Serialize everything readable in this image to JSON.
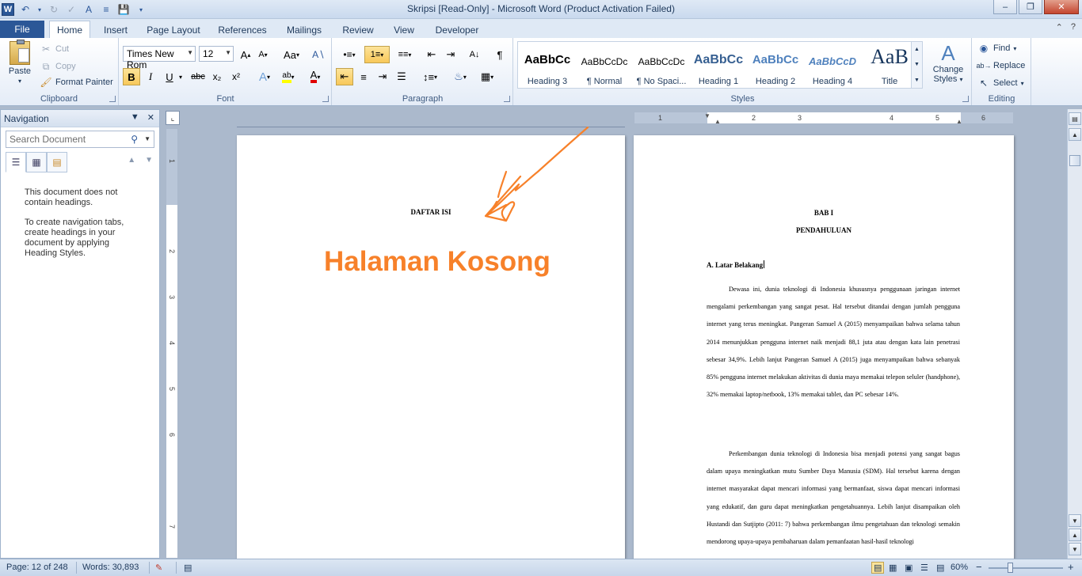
{
  "window": {
    "title": "Skripsi [Read-Only]  -  Microsoft Word (Product Activation Failed)",
    "minimize": "–",
    "restore": "❐",
    "close": "✕"
  },
  "tabs": {
    "file": "File",
    "items": [
      "Home",
      "Insert",
      "Page Layout",
      "References",
      "Mailings",
      "Review",
      "View",
      "Developer"
    ],
    "help": "?"
  },
  "ribbon": {
    "clipboard": {
      "label": "Clipboard",
      "paste": "Paste",
      "cut": "Cut",
      "copy": "Copy",
      "format_painter": "Format Painter"
    },
    "font": {
      "label": "Font",
      "font_name": "Times New Rom",
      "font_size": "12",
      "bold": "B",
      "italic": "I",
      "underline": "U",
      "strike": "abc",
      "subscript": "x₂",
      "superscript": "x²"
    },
    "paragraph": {
      "label": "Paragraph"
    },
    "styles": {
      "label": "Styles",
      "items": [
        {
          "sample": "AaBbCc",
          "name": "Heading 3"
        },
        {
          "sample": "AaBbCcDc",
          "name": "¶ Normal"
        },
        {
          "sample": "AaBbCcDc",
          "name": "¶ No Spaci..."
        },
        {
          "sample": "AaBbCc",
          "name": "Heading 1"
        },
        {
          "sample": "AaBbCc",
          "name": "Heading 2"
        },
        {
          "sample": "AaBbCcD",
          "name": "Heading 4"
        },
        {
          "sample": "AaB",
          "name": "Title"
        }
      ],
      "change_styles": "Change",
      "change_styles_2": "Styles"
    },
    "editing": {
      "label": "Editing",
      "find": "Find",
      "replace": "Replace",
      "select": "Select"
    }
  },
  "navigation": {
    "title": "Navigation",
    "search_placeholder": "Search Document",
    "msg1": "This document does not contain headings.",
    "msg2": "To create navigation tabs, create headings in your document by applying Heading Styles."
  },
  "ruler": {
    "h_numbers": [
      "1",
      "2",
      "3",
      "4",
      "5",
      "6"
    ],
    "v_numbers": [
      "1",
      "2",
      "3",
      "4",
      "5",
      "6",
      "7"
    ]
  },
  "document": {
    "page1": {
      "title": "DAFTAR ISI",
      "annotation": "Halaman Kosong"
    },
    "page2": {
      "bab": "BAB I",
      "bab_title": "PENDAHULUAN",
      "subheading": "A.  Latar Belakang",
      "para1": "Dewasa ini, dunia teknologi di Indonesia khususnya penggunaan jaringan internet mengalami perkembangan yang sangat pesat. Hal tersebut ditandai dengan jumlah pengguna internet yang terus meningkat. Pangeran Samuel A (2015) menyampaikan bahwa selama tahun 2014 menunjukkan pengguna internet naik menjadi 88,1 juta atau dengan kata lain penetrasi sebesar 34,9%. Lebih lanjut Pangeran  Samuel A (2015) juga menyampaikan bahwa sebanyak 85% pengguna internet melakukan aktivitas di dunia maya memakai telepon seluler (handphone), 32% memakai laptop/netbook, 13% memakai tablet, dan PC sebesar 14%.",
      "para2": "Perkembangan dunia teknologi di Indonesia bisa menjadi potensi yang sangat bagus dalam upaya meningkatkan mutu Sumber Daya Manusia (SDM). Hal tersebut karena dengan internet masyarakat dapat mencari informasi yang bermanfaat, siswa dapat mencari informasi yang edukatif, dan guru dapat meningkatkan pengetahuannya. Lebih lanjut disampaikan oleh Hustandi dan Sutjipto (2011: 7) bahwa perkembangan ilmu pengetahuan dan teknologi semakin mendorong upaya-upaya pembaharuan dalam pemanfaatan hasil-hasil teknologi"
    }
  },
  "status": {
    "page": "Page: 12 of 248",
    "words": "Words: 30,893",
    "zoom": "60%",
    "zoom_out": "−",
    "zoom_in": "+"
  },
  "colors": {
    "annotation": "#f7812a",
    "file_tab": "#2b5797"
  }
}
